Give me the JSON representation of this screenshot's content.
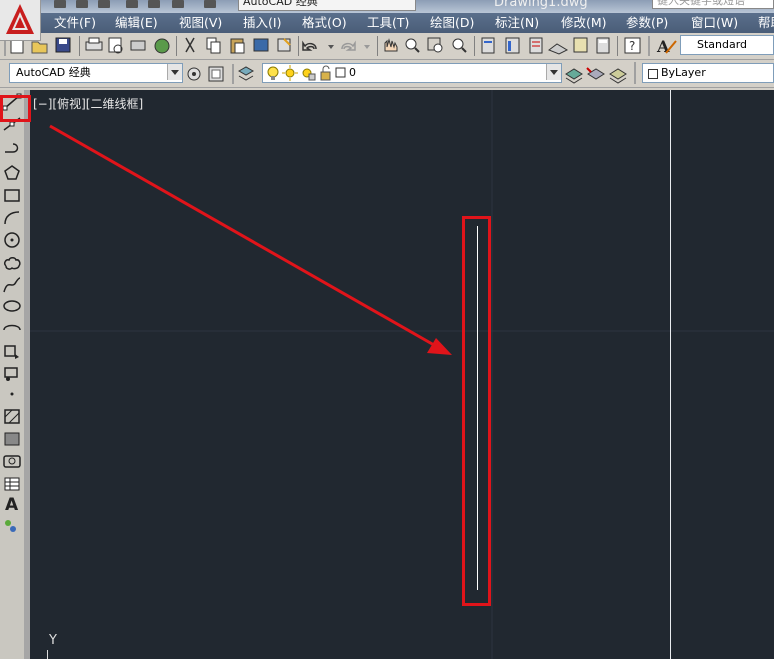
{
  "title_bar": {
    "workspace": "AutoCAD 经典",
    "document": "Drawing1.dwg",
    "search_placeholder": "键入关键字或短语"
  },
  "menu": {
    "items": [
      "文件(F)",
      "编辑(E)",
      "视图(V)",
      "插入(I)",
      "格式(O)",
      "工具(T)",
      "绘图(D)",
      "标注(N)",
      "修改(M)",
      "参数(P)",
      "窗口(W)",
      "帮助(H)"
    ]
  },
  "toolbar": {
    "text_style": "Standard"
  },
  "properties_bar": {
    "workspace": "AutoCAD 经典",
    "layer": "0",
    "color": "ByLayer"
  },
  "left_toolbar": {
    "text_tool_glyph": "A"
  },
  "viewport": {
    "label": "[−][俯视][二维线框]",
    "axis_label": "Y"
  },
  "colors": {
    "canvas": "#212830",
    "highlight": "#e0141a",
    "menubar": "#4e6280",
    "line": "#ffffff"
  }
}
